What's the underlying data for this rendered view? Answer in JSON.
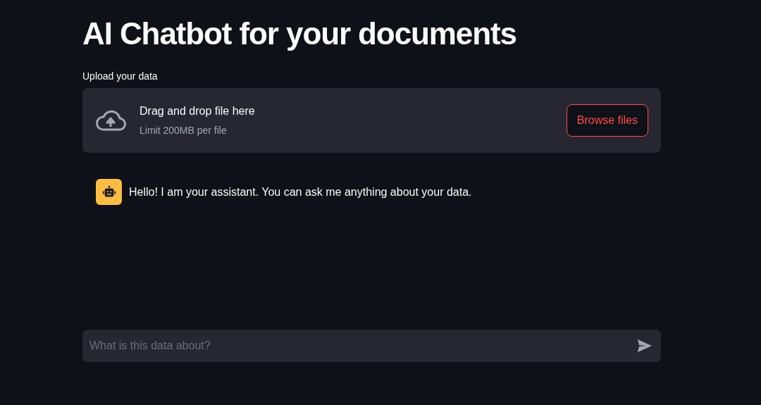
{
  "title": "AI Chatbot for your documents",
  "uploader": {
    "label": "Upload your data",
    "instruction": "Drag and drop file here",
    "limit": "Limit 200MB per file",
    "button": "Browse files"
  },
  "messages": [
    {
      "kind": "assistant",
      "text": "Hello! I am your assistant. You can ask me anything about your data."
    }
  ],
  "chat_input": {
    "placeholder": "What is this data about?"
  }
}
